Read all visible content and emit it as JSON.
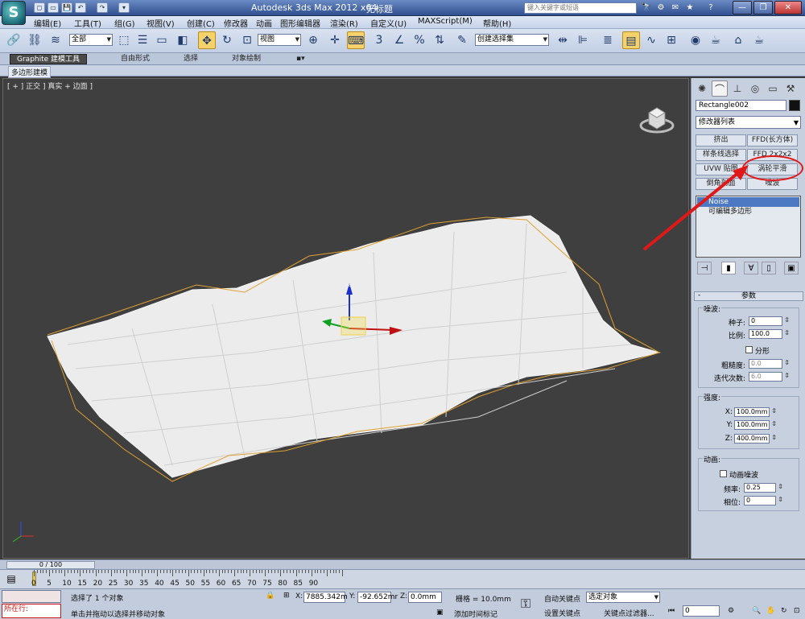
{
  "titlebar": {
    "app_title": "Autodesk 3ds Max  2012 x64",
    "file": "无标题",
    "search_placeholder": "键入关键字或短语",
    "quick_access": [
      "◻",
      "▭",
      "💾",
      "↶",
      "↷",
      "▾"
    ],
    "right_icons": [
      "🔭",
      "⚙",
      "✉",
      "★",
      "?"
    ]
  },
  "menus": [
    "编辑(E)",
    "工具(T)",
    "组(G)",
    "视图(V)",
    "创建(C)",
    "修改器",
    "动画",
    "图形编辑器",
    "渲染(R)",
    "自定义(U)",
    "MAXScript(M)",
    "帮助(H)"
  ],
  "toolbar": {
    "filter_select": "全部",
    "refcoord_select": "视图",
    "selection_set": "创建选择集"
  },
  "ribbon": {
    "tabs": [
      "Graphite 建模工具",
      "自由形式",
      "选择",
      "对象绘制"
    ],
    "sub_label": "多边形建模"
  },
  "viewport": {
    "label": "[ + ] 正交 ] 真实 + 边面 ]"
  },
  "command_panel": {
    "object_name": "Rectangle002",
    "modifier_list": "修改器列表",
    "modifier_buttons": [
      "挤出",
      "FFD(长方体)",
      "样条线选择",
      "FFD 2x2x2",
      "UVW 贴图",
      "涡轮平滑",
      "倒角剖面",
      "噪波"
    ],
    "stack": [
      "Noise",
      "可编辑多边形"
    ],
    "params": {
      "title": "参数",
      "noise_group": "噪波:",
      "seed_label": "种子:",
      "seed_value": "0",
      "scale_label": "比例:",
      "scale_value": "100.0",
      "fractal_label": "分形",
      "roughness_label": "粗糙度:",
      "roughness_value": "0.0",
      "iterations_label": "迭代次数:",
      "iterations_value": "6.0",
      "strength_group": "强度:",
      "x_label": "X:",
      "x_value": "100.0mm",
      "y_label": "Y:",
      "y_value": "100.0mm",
      "z_label": "Z:",
      "z_value": "400.0mm",
      "anim_group": "动画:",
      "anim_noise_label": "动画噪波",
      "freq_label": "频率:",
      "freq_value": "0.25",
      "phase_label": "相位:",
      "phase_value": "0"
    }
  },
  "timeline": {
    "frame_display": "0 / 100",
    "ticks": [
      "0",
      "5",
      "10",
      "15",
      "20",
      "25",
      "30",
      "35",
      "40",
      "45",
      "50",
      "55",
      "60",
      "65",
      "70",
      "75",
      "80",
      "85",
      "90"
    ]
  },
  "status": {
    "mode": "所在行:",
    "selection_msg": "选择了 1 个对象",
    "prompt_msg": "单击并拖动以选择并移动对象",
    "x_label": "X:",
    "x_value": "7885.342m",
    "y_label": "Y:",
    "y_value": "-92.652mr",
    "z_label": "Z:",
    "z_value": "0.0mm",
    "grid": "栅格 = 10.0mm",
    "add_time_tag": "添加时间标记",
    "auto_key": "自动关键点",
    "selected_object": "选定对象",
    "set_key": "设置关键点",
    "key_filters": "关键点过滤器...",
    "frame_value": "0"
  }
}
